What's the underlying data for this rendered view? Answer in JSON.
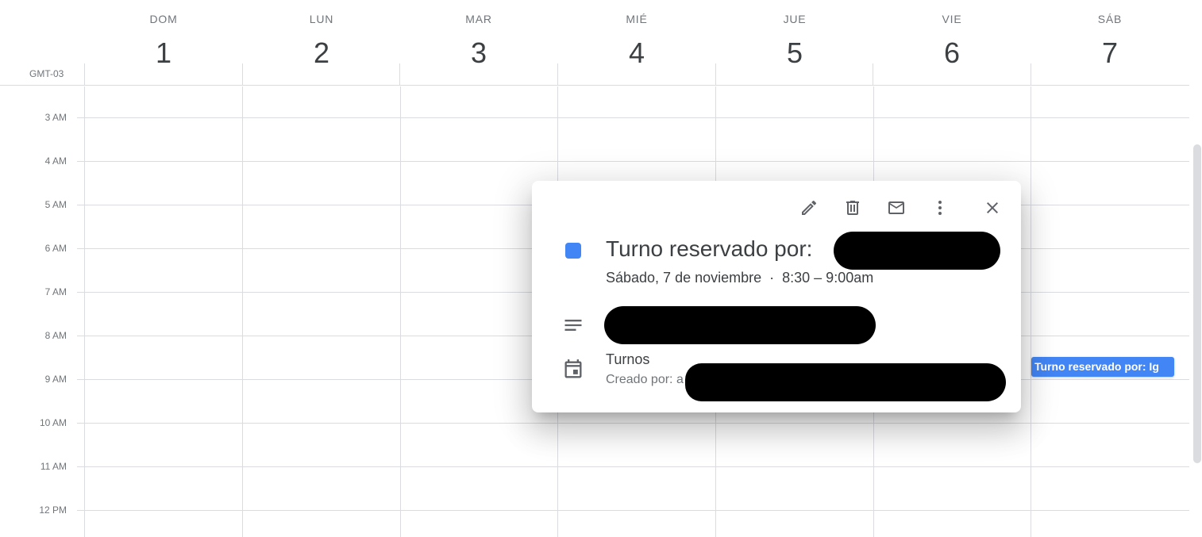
{
  "header": {
    "timezone": "GMT-03",
    "days": [
      {
        "name": "DOM",
        "number": "1"
      },
      {
        "name": "LUN",
        "number": "2"
      },
      {
        "name": "MAR",
        "number": "3"
      },
      {
        "name": "MIÉ",
        "number": "4"
      },
      {
        "name": "JUE",
        "number": "5"
      },
      {
        "name": "VIE",
        "number": "6"
      },
      {
        "name": "SÁB",
        "number": "7"
      }
    ]
  },
  "grid": {
    "hours": [
      "3 AM",
      "4 AM",
      "5 AM",
      "6 AM",
      "7 AM",
      "8 AM",
      "9 AM",
      "10 AM",
      "11 AM",
      "12 PM"
    ]
  },
  "event_chip": {
    "label": "Turno reservado por: Ig",
    "color": "#4285f4"
  },
  "popup": {
    "icons": [
      "edit-icon",
      "delete-icon",
      "email-icon",
      "more-options-icon",
      "close-icon"
    ],
    "title": "Turno reservado por:",
    "date": "Sábado, 7 de noviembre",
    "separator": "·",
    "time": "8:30 – 9:00am",
    "calendar_name": "Turnos",
    "created_by": "Creado por: a",
    "event_color": "#4285f4"
  }
}
